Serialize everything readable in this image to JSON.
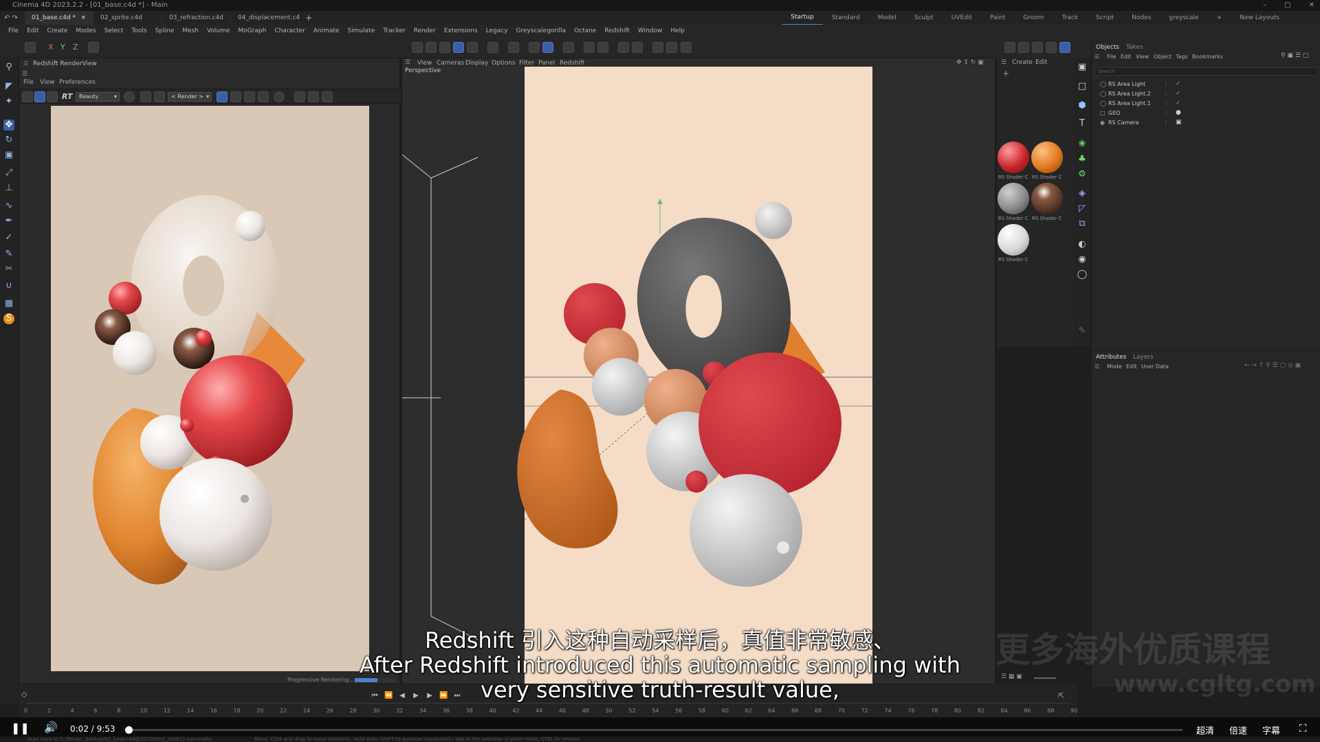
{
  "window": {
    "title": "Cinema 4D 2023.2.2 - [01_base.c4d *] - Main"
  },
  "doc_tabs": [
    {
      "label": "01_base.c4d *",
      "active": true
    },
    {
      "label": "02_sprite.c4d",
      "active": false
    },
    {
      "label": "03_refraction.c4d",
      "active": false
    },
    {
      "label": "04_displacement.c4d",
      "active": false
    }
  ],
  "layouts": [
    {
      "label": "Startup",
      "active": true
    },
    {
      "label": "Standard",
      "active": false
    },
    {
      "label": "Model",
      "active": false
    },
    {
      "label": "Sculpt",
      "active": false
    },
    {
      "label": "UVEdit",
      "active": false
    },
    {
      "label": "Paint",
      "active": false
    },
    {
      "label": "Groom",
      "active": false
    },
    {
      "label": "Track",
      "active": false
    },
    {
      "label": "Script",
      "active": false
    },
    {
      "label": "Nodes",
      "active": false
    },
    {
      "label": "greyscale",
      "active": false
    }
  ],
  "new_layouts": "New Layouts",
  "menu": [
    "File",
    "Edit",
    "Create",
    "Modes",
    "Select",
    "Tools",
    "Spline",
    "Mesh",
    "Volume",
    "MoGraph",
    "Character",
    "Animate",
    "Simulate",
    "Tracker",
    "Render",
    "Extensions",
    "Legacy",
    "Greyscalegorilla",
    "Octane",
    "Redshift",
    "Window",
    "Help"
  ],
  "coord_labels": [
    "X",
    "Y",
    "Z"
  ],
  "renderview": {
    "title": "Redshift RenderView",
    "menu": [
      "File",
      "View",
      "Preferences"
    ],
    "rt_label": "RT",
    "aov_select": "Beauty",
    "render_select": "< Render >",
    "status": "Progressive Rendering...",
    "progress_fraction": 0.55
  },
  "viewport": {
    "menu": [
      "View",
      "Cameras",
      "Display",
      "Options",
      "Filter",
      "Panel",
      "Redshift"
    ],
    "label": "Perspective"
  },
  "materials": {
    "menu": [
      "Create",
      "Edit"
    ],
    "items": [
      {
        "label": "RS Shader C",
        "color": "#c8252b"
      },
      {
        "label": "RS Shader C",
        "color": "#e07a20"
      },
      {
        "label": "RS Shader C",
        "color": "#8a8a8a"
      },
      {
        "label": "RS Shader C",
        "color": "#3a1e18"
      },
      {
        "label": "RS Shader C",
        "color": "#d8d8d8"
      }
    ]
  },
  "objects": {
    "tabs": [
      {
        "label": "Objects",
        "active": true
      },
      {
        "label": "Takes",
        "active": false
      }
    ],
    "menu": [
      "File",
      "Edit",
      "View",
      "Object",
      "Tags",
      "Bookmarks"
    ],
    "search_placeholder": "Search",
    "items": [
      {
        "name": "RS Area Light",
        "checked": true
      },
      {
        "name": "RS Area Light.2",
        "checked": true
      },
      {
        "name": "RS Area Light.1",
        "checked": true
      },
      {
        "name": "GEO",
        "checked": false
      },
      {
        "name": "RS Camera",
        "checked": false
      }
    ]
  },
  "attributes": {
    "tabs": [
      {
        "label": "Attributes",
        "active": true
      },
      {
        "label": "Layers",
        "active": false
      }
    ],
    "menu": [
      "Mode",
      "Edit",
      "User Data"
    ]
  },
  "timeline": {
    "ticks": [
      "0",
      "2",
      "4",
      "6",
      "8",
      "10",
      "12",
      "14",
      "16",
      "18",
      "20",
      "22",
      "24",
      "26",
      "28",
      "30",
      "32",
      "34",
      "36",
      "38",
      "40",
      "42",
      "44",
      "46",
      "48",
      "50",
      "52",
      "54",
      "56",
      "58",
      "60",
      "62",
      "64",
      "66",
      "68",
      "70",
      "72",
      "74",
      "76",
      "78",
      "80",
      "82",
      "84",
      "86",
      "88",
      "90"
    ]
  },
  "status_bar": {
    "left": "Auto Save to D:/Temp/...backup/01_base.c4d@20230810_100611 successful",
    "right": "Move: Click and drag to move elements. Hold down SHIFT to quantize movement / add to the selection in point mode, CTRL to remove."
  },
  "player": {
    "time": "0:02 / 9:53",
    "progress_fraction": 0.002,
    "buttons": [
      "超清",
      "倍速",
      "字幕"
    ]
  },
  "subtitles": {
    "line1": "Redshift 引入这种自动采样后，真值非常敏感、",
    "line2": "After Redshift introduced this automatic sampling with",
    "line3": "very sensitive truth-result value,"
  },
  "watermark": {
    "text": "更多海外优质课程",
    "url": "www.cgltg.com"
  }
}
